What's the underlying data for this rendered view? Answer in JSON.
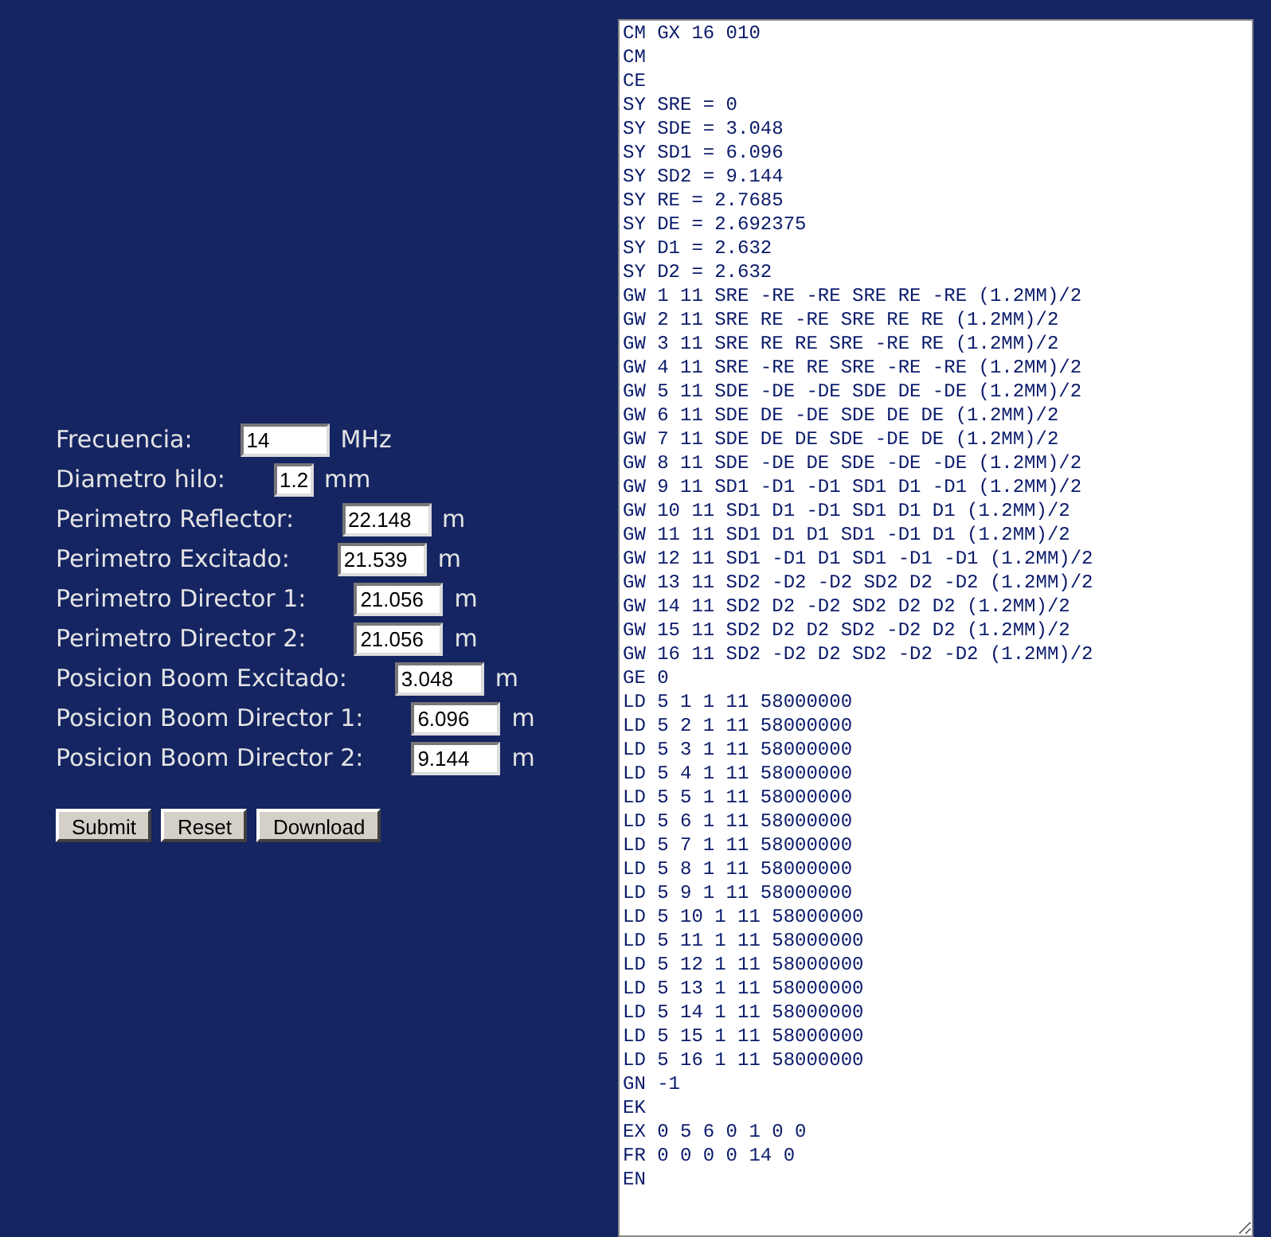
{
  "form": {
    "fields": [
      {
        "label": "Frecuencia:",
        "value": "14",
        "unit": "MHz"
      },
      {
        "label": "Diametro hilo:",
        "value": "1.2",
        "unit": "mm"
      },
      {
        "label": "Perimetro Reflector:",
        "value": "22.148",
        "unit": "m"
      },
      {
        "label": "Perimetro Excitado:",
        "value": "21.539",
        "unit": "m"
      },
      {
        "label": "Perimetro Director 1:",
        "value": "21.056",
        "unit": "m"
      },
      {
        "label": "Perimetro Director 2:",
        "value": "21.056",
        "unit": "m"
      },
      {
        "label": "Posicion Boom Excitado:",
        "value": "3.048",
        "unit": "m"
      },
      {
        "label": "Posicion Boom Director 1:",
        "value": "6.096",
        "unit": "m"
      },
      {
        "label": "Posicion Boom Director 2:",
        "value": "9.144",
        "unit": "m"
      }
    ],
    "buttons": [
      "Submit",
      "Reset",
      "Download"
    ]
  },
  "output": {
    "lines": [
      "CM GX 16 010",
      "CM",
      "CE",
      "SY SRE = 0",
      "SY SDE = 3.048",
      "SY SD1 = 6.096",
      "SY SD2 = 9.144",
      "SY RE = 2.7685",
      "SY DE = 2.692375",
      "SY D1 = 2.632",
      "SY D2 = 2.632",
      "GW 1 11 SRE -RE -RE SRE RE -RE (1.2MM)/2",
      "GW 2 11 SRE RE -RE SRE RE RE (1.2MM)/2",
      "GW 3 11 SRE RE RE SRE -RE RE (1.2MM)/2",
      "GW 4 11 SRE -RE RE SRE -RE -RE (1.2MM)/2",
      "GW 5 11 SDE -DE -DE SDE DE -DE (1.2MM)/2",
      "GW 6 11 SDE DE -DE SDE DE DE (1.2MM)/2",
      "GW 7 11 SDE DE DE SDE -DE DE (1.2MM)/2",
      "GW 8 11 SDE -DE DE SDE -DE -DE (1.2MM)/2",
      "GW 9 11 SD1 -D1 -D1 SD1 D1 -D1 (1.2MM)/2",
      "GW 10 11 SD1 D1 -D1 SD1 D1 D1 (1.2MM)/2",
      "GW 11 11 SD1 D1 D1 SD1 -D1 D1 (1.2MM)/2",
      "GW 12 11 SD1 -D1 D1 SD1 -D1 -D1 (1.2MM)/2",
      "GW 13 11 SD2 -D2 -D2 SD2 D2 -D2 (1.2MM)/2",
      "GW 14 11 SD2 D2 -D2 SD2 D2 D2 (1.2MM)/2",
      "GW 15 11 SD2 D2 D2 SD2 -D2 D2 (1.2MM)/2",
      "GW 16 11 SD2 -D2 D2 SD2 -D2 -D2 (1.2MM)/2",
      "GE 0",
      "LD 5 1 1 11 58000000",
      "LD 5 2 1 11 58000000",
      "LD 5 3 1 11 58000000",
      "LD 5 4 1 11 58000000",
      "LD 5 5 1 11 58000000",
      "LD 5 6 1 11 58000000",
      "LD 5 7 1 11 58000000",
      "LD 5 8 1 11 58000000",
      "LD 5 9 1 11 58000000",
      "LD 5 10 1 11 58000000",
      "LD 5 11 1 11 58000000",
      "LD 5 12 1 11 58000000",
      "LD 5 13 1 11 58000000",
      "LD 5 14 1 11 58000000",
      "LD 5 15 1 11 58000000",
      "LD 5 16 1 11 58000000",
      "GN -1",
      "EK",
      "EX 0 5 6 0 1 0 0",
      "FR 0 0 0 0 14 0",
      "EN"
    ]
  }
}
